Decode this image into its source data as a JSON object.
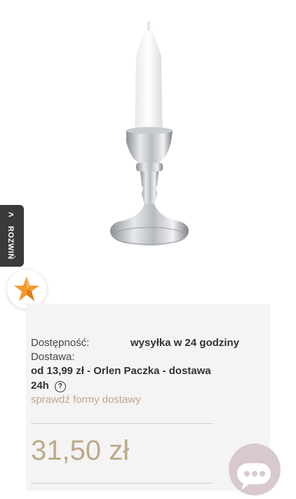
{
  "side_tab": {
    "label": "ROZWIŃ",
    "icon": "chevron-right-icon"
  },
  "badge": {
    "icon": "star-logo-icon"
  },
  "availability": {
    "label": "Dostępność:",
    "value": "wysyłka w 24 godziny"
  },
  "delivery": {
    "label": "Dostawa:",
    "value_line1": "od 13,99 zł - Orlen Paczka - dostawa",
    "value_line2": "24h",
    "help_icon": "question-icon",
    "help_glyph": "?",
    "link": "sprawdź formy dostawy"
  },
  "price": "31,50 zł",
  "chat": {
    "icon": "chat-bubble-icon"
  },
  "colors": {
    "accent": "#bda98a",
    "panel": "#f4f4f4",
    "tab": "#3a3a3a",
    "chat": "#d7c9cd"
  }
}
